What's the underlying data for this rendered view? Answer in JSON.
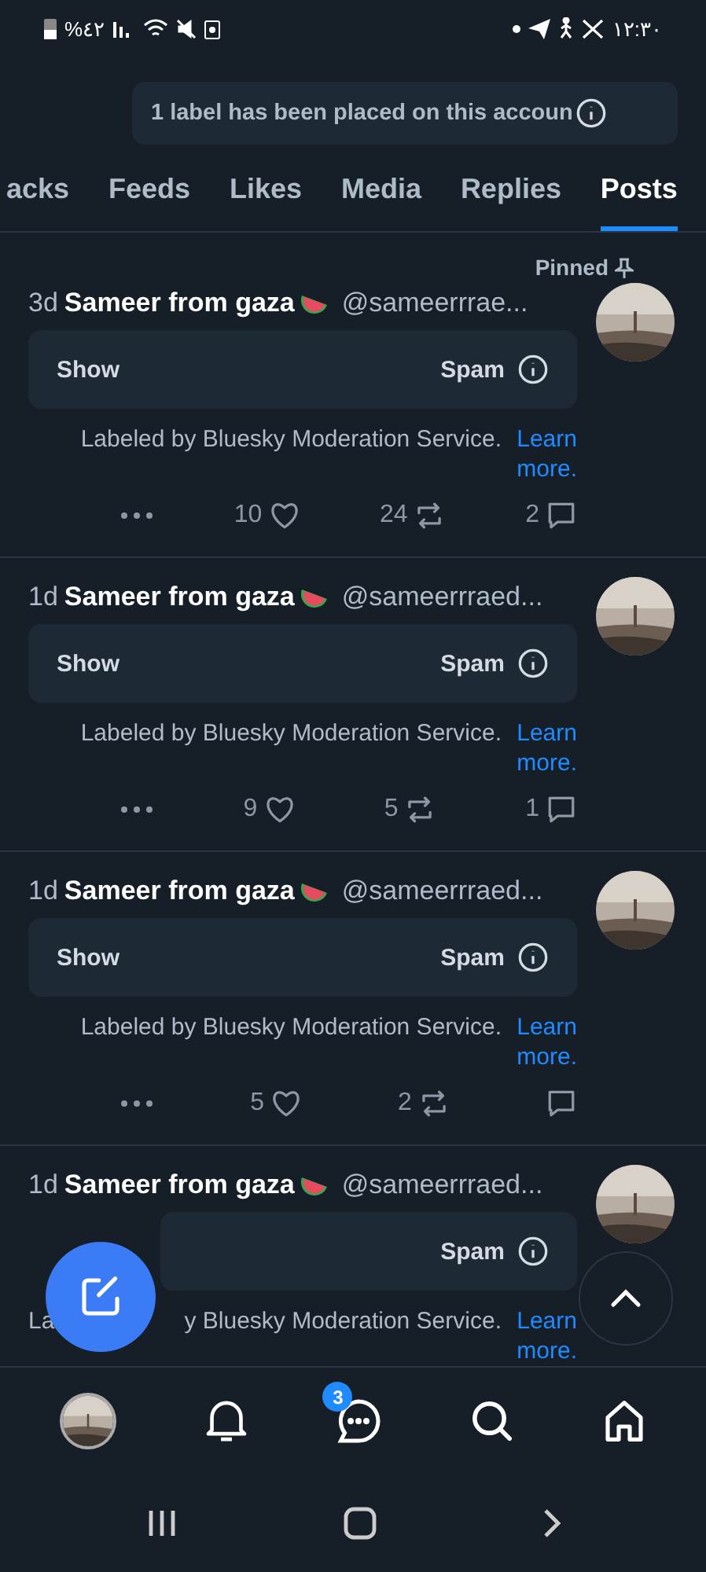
{
  "status_bar": {
    "battery": "%٤٢",
    "time": "١٢:٣٠"
  },
  "label_notice": {
    "text": "1 label has been placed on this accoun"
  },
  "tabs": [
    {
      "label": "acks",
      "selected": false
    },
    {
      "label": "Feeds",
      "selected": false
    },
    {
      "label": "Likes",
      "selected": false
    },
    {
      "label": "Media",
      "selected": false
    },
    {
      "label": "Replies",
      "selected": false
    },
    {
      "label": "Posts",
      "selected": true
    }
  ],
  "posts": [
    {
      "pinned": true,
      "pinned_label": "Pinned",
      "age": "3d",
      "name": "Sameer from gaza",
      "handle": "@sameerrrae...",
      "show_label": "Show",
      "warning": "Spam",
      "labeled_by": "Labeled by Bluesky Moderation Service.",
      "learn_more": "Learn more.",
      "likes": "10",
      "reposts": "24",
      "replies": "2"
    },
    {
      "pinned": false,
      "age": "1d",
      "name": "Sameer from gaza",
      "handle": "@sameerrraed...",
      "show_label": "Show",
      "warning": "Spam",
      "labeled_by": "Labeled by Bluesky Moderation Service.",
      "learn_more": "Learn more.",
      "likes": "9",
      "reposts": "5",
      "replies": "1"
    },
    {
      "pinned": false,
      "age": "1d",
      "name": "Sameer from gaza",
      "handle": "@sameerrraed...",
      "show_label": "Show",
      "warning": "Spam",
      "labeled_by": "Labeled by Bluesky Moderation Service.",
      "learn_more": "Learn more.",
      "likes": "5",
      "reposts": "2"
    },
    {
      "pinned": false,
      "age": "1d",
      "name": "Sameer from gaza",
      "handle": "@sameerrraed...",
      "warning": "Spam",
      "labeled_prefix": "La",
      "labeled_by": "y Bluesky Moderation Service.",
      "learn_more": "Learn more."
    }
  ],
  "bottom_nav": {
    "messages_badge": "3"
  }
}
